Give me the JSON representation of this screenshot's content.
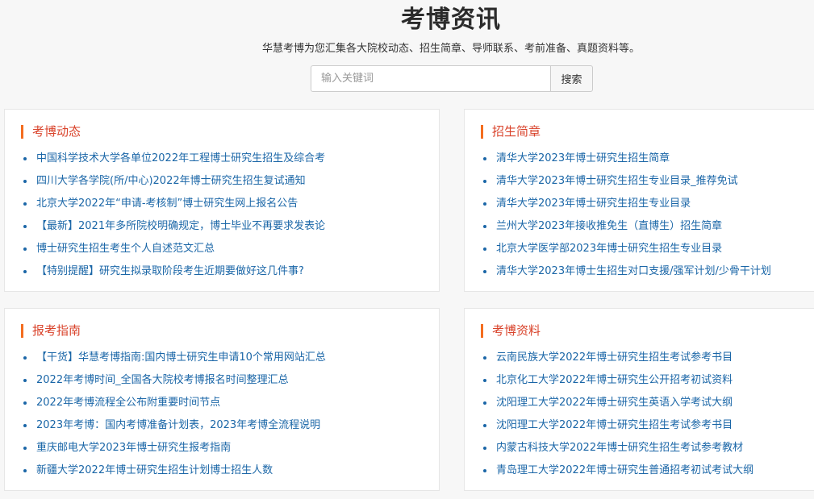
{
  "header": {
    "title": "考博资讯",
    "subtitle": "华慧考博为您汇集各大院校动态、招生简章、导师联系、考前准备、真题资料等。"
  },
  "search": {
    "placeholder": "输入关键词",
    "value": "",
    "button_label": "搜索"
  },
  "colors": {
    "accent": "#f46d1f",
    "heading": "#d9432b",
    "link": "#1a66a7"
  },
  "sections": [
    {
      "title": "考博动态",
      "items": [
        "中国科学技术大学各单位2022年工程博士研究生招生及综合考",
        "四川大学各学院(所/中心)2022年博士研究生招生复试通知",
        "北京大学2022年“申请-考核制”博士研究生网上报名公告",
        "【最新】2021年多所院校明确规定，博士毕业不再要求发表论",
        "博士研究生招生考生个人自述范文汇总",
        "【特别提醒】研究生拟录取阶段考生近期要做好这几件事?"
      ]
    },
    {
      "title": "招生简章",
      "items": [
        "清华大学2023年博士研究生招生简章",
        "清华大学2023年博士研究生招生专业目录_推荐免试",
        "清华大学2023年博士研究生招生专业目录",
        "兰州大学2023年接收推免生（直博生）招生简章",
        "北京大学医学部2023年博士研究生招生专业目录",
        "清华大学2023年博士生招生对口支援/强军计划/少骨干计划"
      ]
    },
    {
      "title": "报考指南",
      "items": [
        "【干货】华慧考博指南:国内博士研究生申请10个常用网站汇总",
        "2022年考博时间_全国各大院校考博报名时间整理汇总",
        "2022年考博流程全公布附重要时间节点",
        "2023年考博：国内考博准备计划表，2023年考博全流程说明",
        "重庆邮电大学2023年博士研究生报考指南",
        "新疆大学2022年博士研究生招生计划博士招生人数"
      ]
    },
    {
      "title": "考博资料",
      "items": [
        "云南民族大学2022年博士研究生招生考试参考书目",
        "北京化工大学2022年博士研究生公开招考初试资料",
        "沈阳理工大学2022年博士研究生英语入学考试大纲",
        "沈阳理工大学2022年博士研究生招生考试参考书目",
        "内蒙古科技大学2022年博士研究生招生考试参考教材",
        "青岛理工大学2022年博士研究生普通招考初试考试大纲"
      ]
    }
  ]
}
